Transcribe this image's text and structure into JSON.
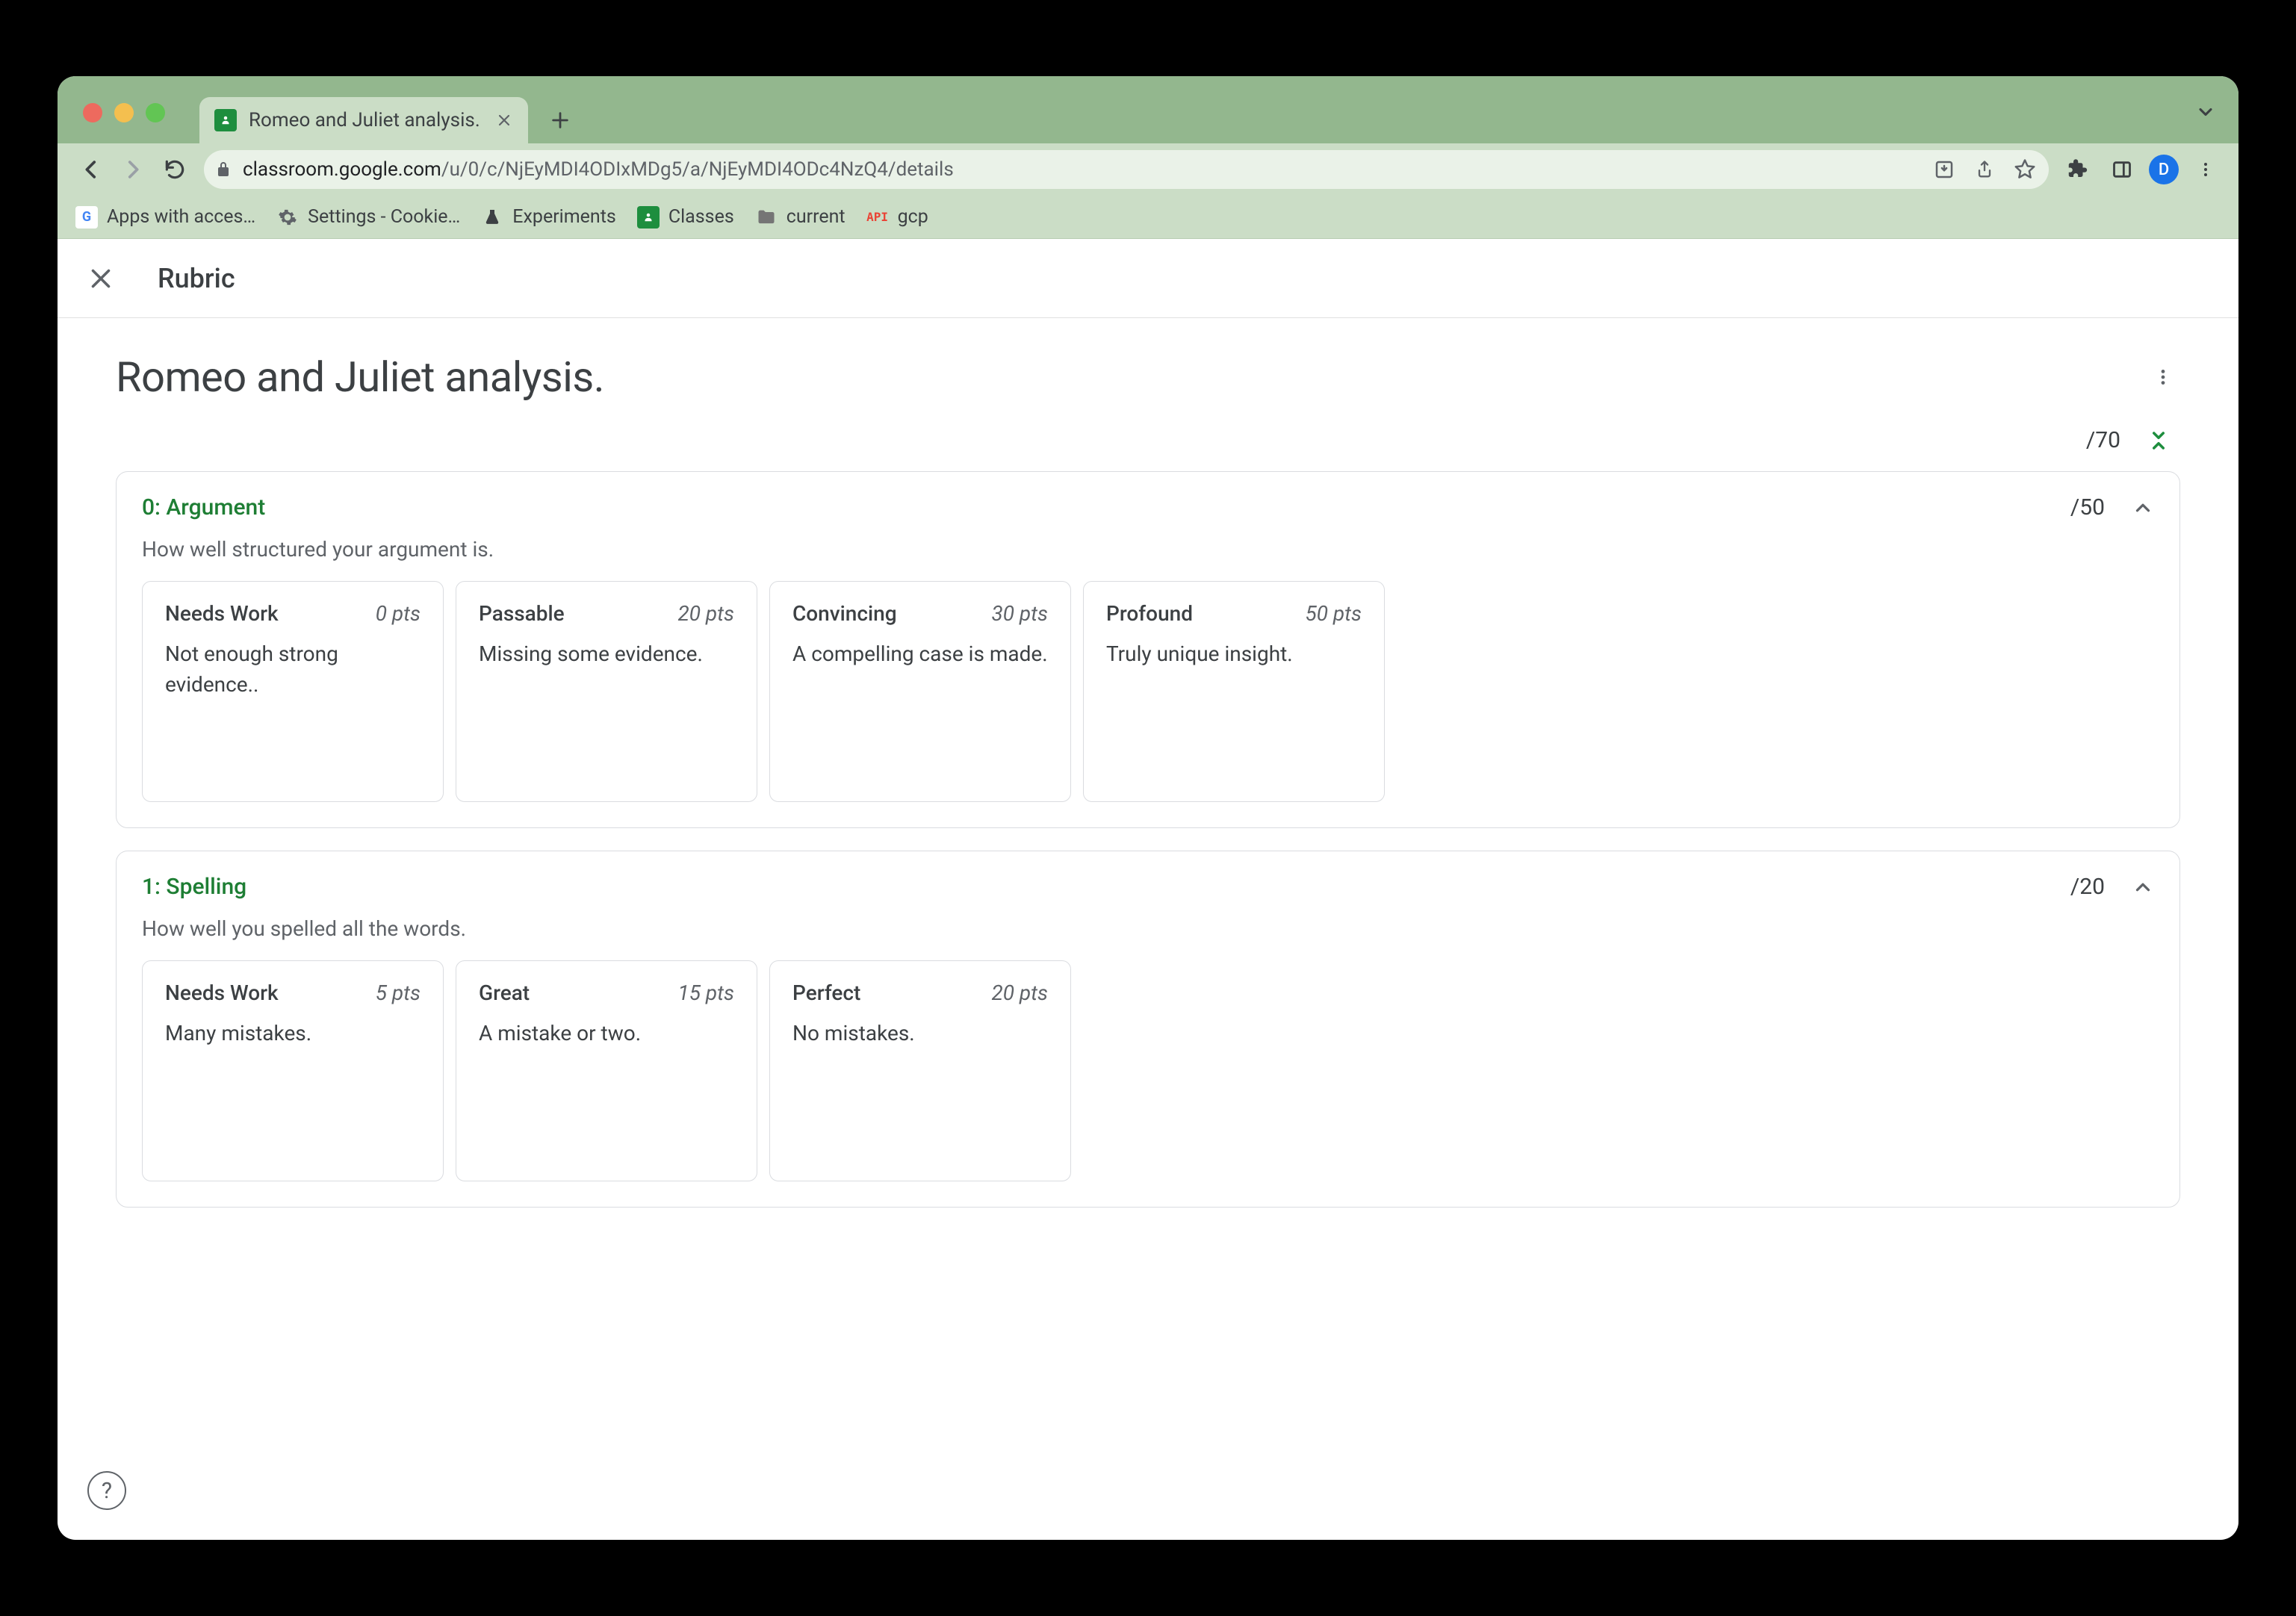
{
  "browser": {
    "tab_title": "Romeo and Juliet analysis.",
    "url_domain": "classroom.google.com",
    "url_path": "/u/0/c/NjEyMDI4ODIxMDg5/a/NjEyMDI4ODc4NzQ4/details",
    "avatar_letter": "D",
    "bookmarks": [
      {
        "label": "Apps with acces…"
      },
      {
        "label": "Settings - Cookie…"
      },
      {
        "label": "Experiments"
      },
      {
        "label": "Classes"
      },
      {
        "label": "current"
      },
      {
        "label": "gcp",
        "prefix": "API"
      }
    ]
  },
  "header": {
    "title": "Rubric"
  },
  "page": {
    "title": "Romeo and Juliet analysis.",
    "total": "/70"
  },
  "criteria": [
    {
      "title": "0: Argument",
      "points": "/50",
      "description": "How well structured your argument is.",
      "levels": [
        {
          "name": "Needs Work",
          "pts": "0 pts",
          "desc": "Not enough strong evidence.."
        },
        {
          "name": "Passable",
          "pts": "20 pts",
          "desc": "Missing some evidence."
        },
        {
          "name": "Convincing",
          "pts": "30 pts",
          "desc": "A compelling case is made."
        },
        {
          "name": "Profound",
          "pts": "50 pts",
          "desc": "Truly unique insight."
        }
      ]
    },
    {
      "title": "1: Spelling",
      "points": "/20",
      "description": "How well you spelled all the words.",
      "levels": [
        {
          "name": "Needs Work",
          "pts": "5 pts",
          "desc": "Many mistakes."
        },
        {
          "name": "Great",
          "pts": "15 pts",
          "desc": "A mistake or two."
        },
        {
          "name": "Perfect",
          "pts": "20 pts",
          "desc": "No mistakes."
        }
      ]
    }
  ]
}
